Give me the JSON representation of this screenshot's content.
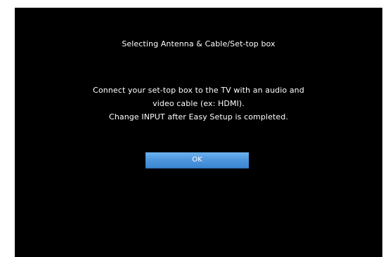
{
  "dialog": {
    "title": "Selecting Antenna & Cable/Set-top box",
    "message_lines": [
      "Connect your set-top box to the TV with an audio and",
      "video cable (ex: HDMI).",
      "Change INPUT after Easy Setup is completed."
    ],
    "ok_label": "OK"
  },
  "colors": {
    "screen_background": "#000000",
    "text": "#ffffff",
    "button_accent": "#4f98de"
  }
}
